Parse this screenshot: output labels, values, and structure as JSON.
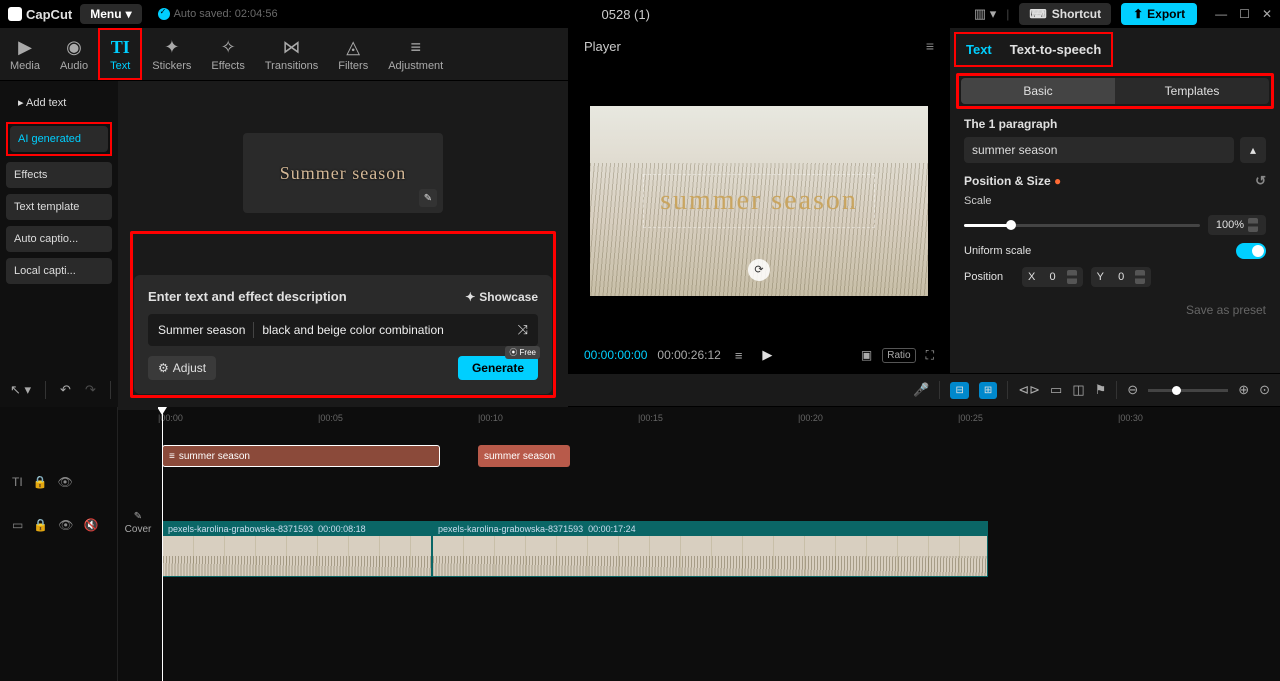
{
  "app": {
    "name": "CapCut",
    "menu": "Menu",
    "autosave": "Auto saved: 02:04:56",
    "title": "0528 (1)"
  },
  "topright": {
    "shortcut": "Shortcut",
    "export": "Export"
  },
  "media_tabs": [
    "Media",
    "Audio",
    "Text",
    "Stickers",
    "Effects",
    "Transitions",
    "Filters",
    "Adjustment"
  ],
  "sub_sidebar": {
    "add_text": "Add text",
    "ai_gen": "AI generated",
    "effects": "Effects",
    "text_template": "Text template",
    "auto_captions": "Auto captio...",
    "local_captions": "Local capti..."
  },
  "thumb_text": "Summer season",
  "ai_box": {
    "title": "Enter text and effect description",
    "showcase": "Showcase",
    "input1": "Summer season",
    "input2": "black and beige color combination",
    "adjust": "Adjust",
    "generate": "Generate",
    "free": "⦿ Free"
  },
  "player": {
    "label": "Player",
    "video_text": "summer season",
    "time_cur": "00:00:00:00",
    "time_dur": "00:00:26:12",
    "ratio": "Ratio"
  },
  "right": {
    "tab_text": "Text",
    "tab_tts": "Text-to-speech",
    "sub_basic": "Basic",
    "sub_templates": "Templates",
    "paragraph_label": "The 1 paragraph",
    "paragraph_value": "summer season",
    "pos_size": "Position & Size",
    "scale": "Scale",
    "scale_val": "100%",
    "uniform": "Uniform scale",
    "position": "Position",
    "x_label": "X",
    "x_val": "0",
    "y_label": "Y",
    "y_val": "0",
    "save_preset": "Save as preset"
  },
  "ruler": [
    "|00:00",
    "|00:05",
    "|00:10",
    "|00:15",
    "|00:20",
    "|00:25",
    "|00:30"
  ],
  "timeline": {
    "text_clip1": "summer season",
    "text_clip2": "summer season",
    "video_clip1_name": "pexels-karolina-grabowska-8371593",
    "video_clip1_time": "00:00:08:18",
    "video_clip2_name": "pexels-karolina-grabowska-8371593",
    "video_clip2_time": "00:00:17:24",
    "cover": "Cover"
  }
}
